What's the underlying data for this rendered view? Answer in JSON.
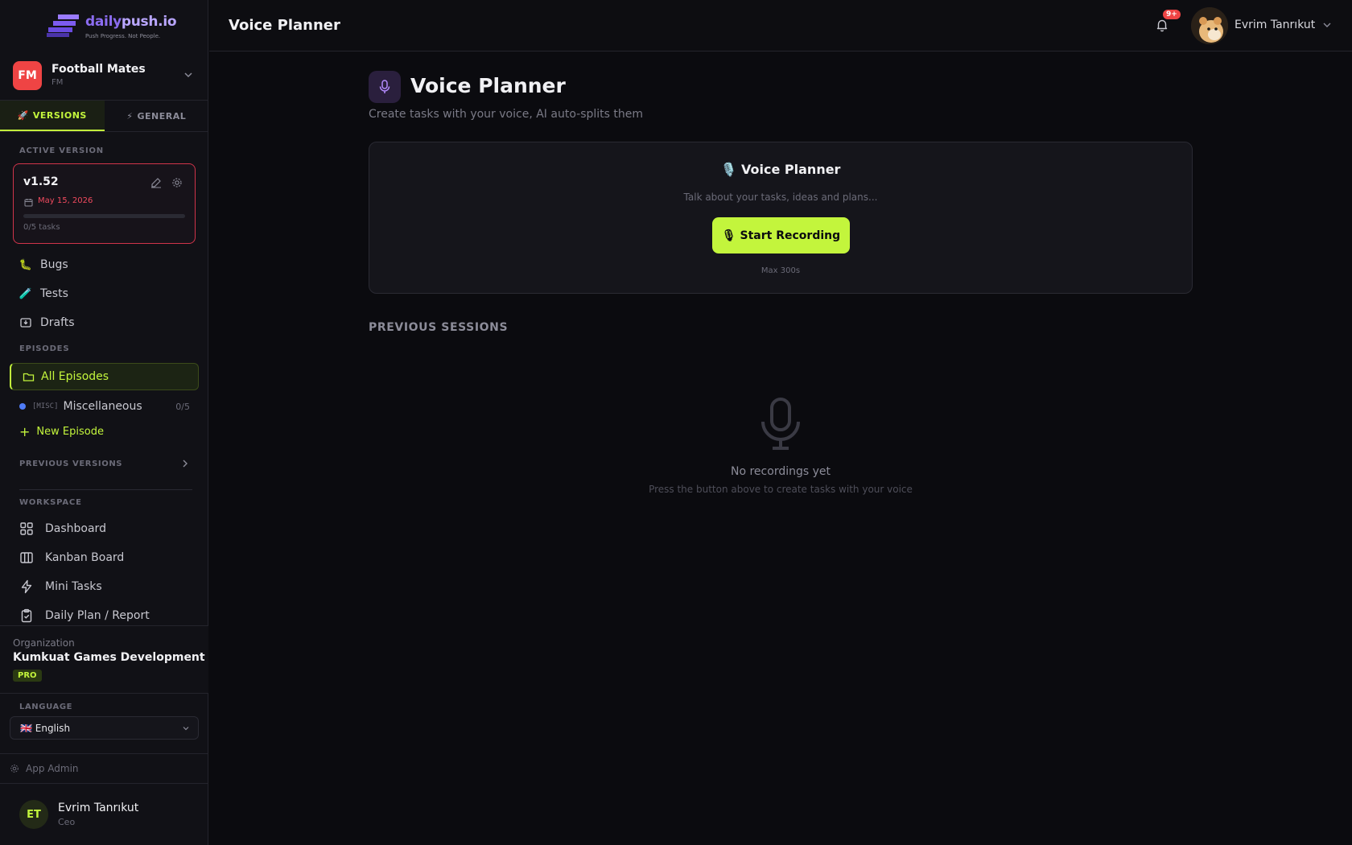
{
  "brand": {
    "name_part1": "daily",
    "name_part2": "push.io",
    "tagline": "Push Progress. Not People."
  },
  "project": {
    "initials": "FM",
    "name": "Football Mates",
    "code": "FM"
  },
  "tabs": [
    {
      "icon": "🚀",
      "label": "VERSIONS",
      "active": true
    },
    {
      "icon": "⚡",
      "label": "GENERAL",
      "active": false
    }
  ],
  "active_version": {
    "section_label": "ACTIVE VERSION",
    "name": "v1.52",
    "date": "May 15, 2026",
    "tasks": "0/5 tasks",
    "progress": 0
  },
  "quick_nav": [
    {
      "icon": "🐛",
      "label": "Bugs"
    },
    {
      "icon": "🧪",
      "label": "Tests"
    },
    {
      "icon": "inbox-icon",
      "label": "Drafts"
    }
  ],
  "episodes": {
    "section_label": "EPISODES",
    "all_label": "All Episodes",
    "items": [
      {
        "tag": "[MISC]",
        "label": "Miscellaneous",
        "count": "0/5",
        "color": "#4f7cf7"
      }
    ],
    "new_label": "New Episode"
  },
  "previous_versions_label": "PREVIOUS VERSIONS",
  "workspace": {
    "section_label": "WORKSPACE",
    "items": [
      {
        "icon": "grid-icon",
        "label": "Dashboard"
      },
      {
        "icon": "kanban-icon",
        "label": "Kanban Board"
      },
      {
        "icon": "bolt-icon",
        "label": "Mini Tasks"
      },
      {
        "icon": "clipboard-icon",
        "label": "Daily Plan / Report"
      }
    ]
  },
  "organization": {
    "label": "Organization",
    "name": "Kumkuat Games Development",
    "plan": "PRO"
  },
  "language": {
    "label": "LANGUAGE",
    "selected": "🇬🇧 English"
  },
  "admin_label": "App Admin",
  "sidebar_user": {
    "initials": "ET",
    "name": "Evrim Tanrıkut",
    "role": "Ceo"
  },
  "topbar": {
    "title": "Voice Planner",
    "notification_count": "9+",
    "user_name": "Evrim Tanrıkut"
  },
  "page": {
    "title": "Voice Planner",
    "subtitle": "Create tasks with your voice, AI auto-splits them"
  },
  "recorder": {
    "title": "🎙️ Voice Planner",
    "subtitle": "Talk about your tasks, ideas and plans...",
    "button_label": "🎙 Start Recording",
    "max_label": "Max 300s"
  },
  "sessions": {
    "heading": "PREVIOUS SESSIONS",
    "empty_title": "No recordings yet",
    "empty_subtitle": "Press the button above to create tasks with your voice"
  },
  "colors": {
    "accent": "#c3f53c",
    "danger": "#ef4444",
    "background": "#0b0b0f"
  }
}
